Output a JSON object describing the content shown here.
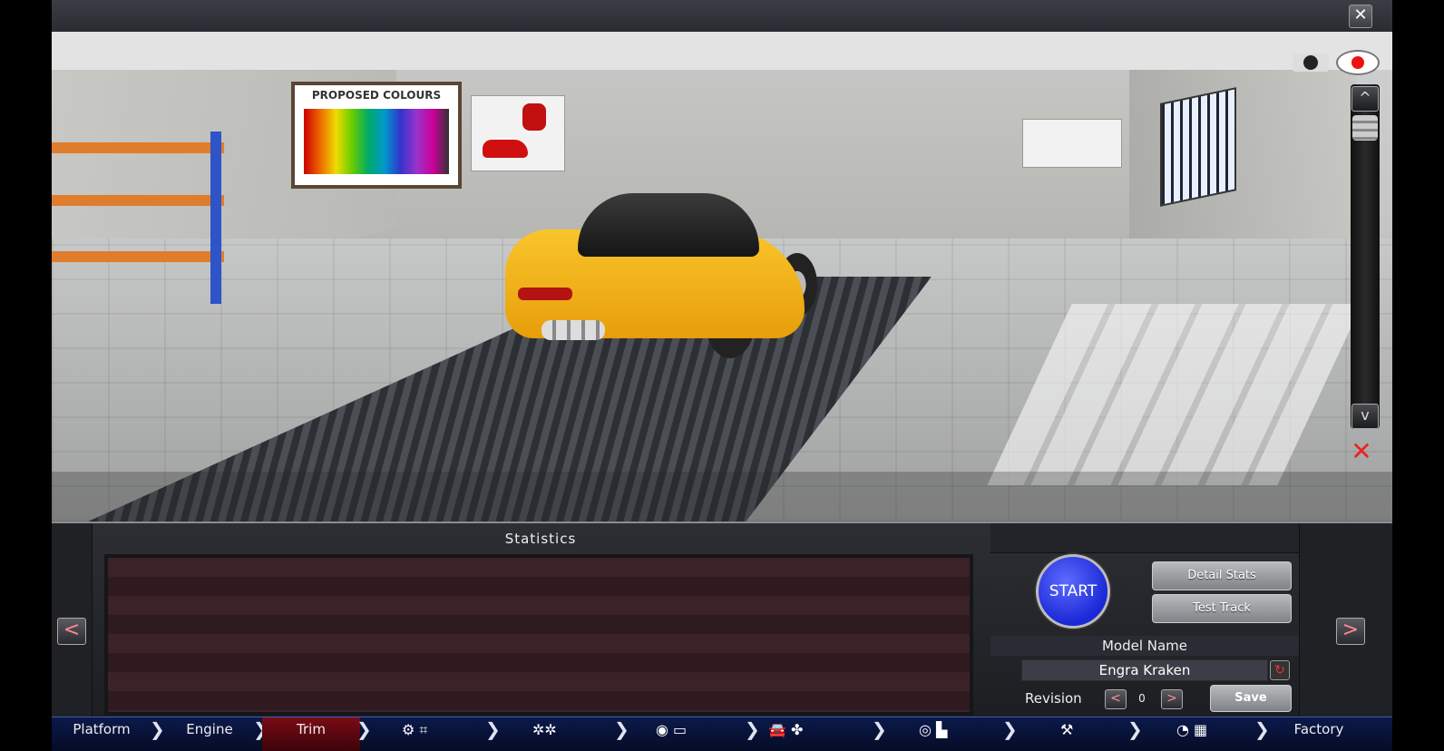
{
  "window": {
    "close_label": "✕"
  },
  "viewport": {
    "poster_title": "PROPOSED COLOURS",
    "zoom_in_label": "^",
    "zoom_out_label": "v"
  },
  "statistics": {
    "title": "Statistics"
  },
  "actions": {
    "start_label": "START",
    "detail_stats_label": "Detail Stats",
    "test_track_label": "Test Track"
  },
  "model": {
    "label": "Model Name",
    "name": "Engra Kraken",
    "revision_label": "Revision",
    "revision_value": "0",
    "save_label": "Save"
  },
  "nav": {
    "prev_label": "<",
    "next_label": ">",
    "tabs": [
      "Platform",
      "Engine",
      "Trim",
      "Factory"
    ],
    "active_tab": "Trim",
    "icon_tabs": [
      "gearbox-icon",
      "wheels-icon",
      "brakes-body-icon",
      "aero-cooling-icon",
      "interior-icon",
      "suspension-icon",
      "testing-icon"
    ]
  },
  "colors": {
    "accent_red": "#7a0b16",
    "start_blue": "#1a28d6",
    "nav_blue": "#0c1a4a"
  }
}
